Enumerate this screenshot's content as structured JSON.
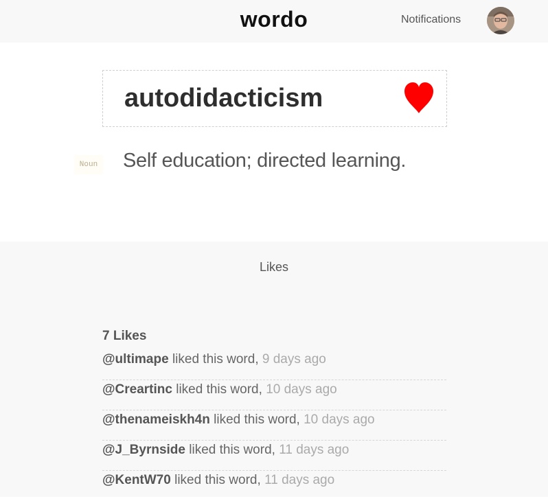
{
  "header": {
    "logo": "wordo",
    "notifications_label": "Notifications"
  },
  "entry": {
    "word": "autodidacticism",
    "part_of_speech": "Noun",
    "definition": "Self education; directed learning.",
    "liked": true,
    "heart_color": "#ff0000"
  },
  "likes": {
    "heading": "Likes",
    "count_label": "7 Likes",
    "items": [
      {
        "user": "@ultimape",
        "action": "liked this word,",
        "time": "9 days ago"
      },
      {
        "user": "@Creartinc",
        "action": "liked this word,",
        "time": "10 days ago"
      },
      {
        "user": "@thenameiskh4n",
        "action": "liked this word,",
        "time": "10 days ago"
      },
      {
        "user": "@J_Byrnside",
        "action": "liked this word,",
        "time": "11 days ago"
      },
      {
        "user": "@KentW70",
        "action": "liked this word,",
        "time": "11 days ago"
      }
    ]
  }
}
